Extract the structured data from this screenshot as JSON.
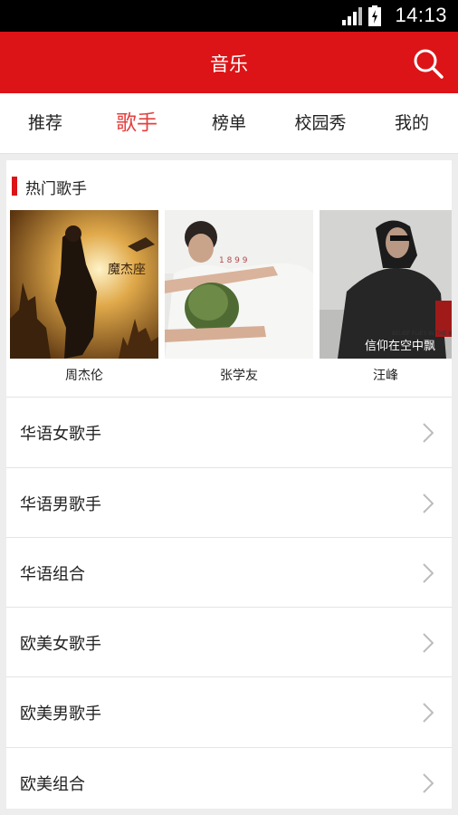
{
  "status": {
    "time": "14:13"
  },
  "appbar": {
    "title": "音乐"
  },
  "tabs": [
    {
      "label": "推荐"
    },
    {
      "label": "歌手"
    },
    {
      "label": "榜单"
    },
    {
      "label": "校园秀"
    },
    {
      "label": "我的"
    }
  ],
  "active_tab": "歌手",
  "hot": {
    "title": "热门歌手",
    "artists": [
      {
        "name": "周杰伦",
        "cover_text": "魔杰座"
      },
      {
        "name": "张学友",
        "cover_text": ""
      },
      {
        "name": "汪峰",
        "cover_text": "信仰在空中飘"
      }
    ]
  },
  "categories": [
    {
      "label": "华语女歌手"
    },
    {
      "label": "华语男歌手"
    },
    {
      "label": "华语组合"
    },
    {
      "label": "欧美女歌手"
    },
    {
      "label": "欧美男歌手"
    },
    {
      "label": "欧美组合"
    }
  ],
  "colors": {
    "brand": "#dc1417",
    "active_tab": "#e3403f"
  }
}
